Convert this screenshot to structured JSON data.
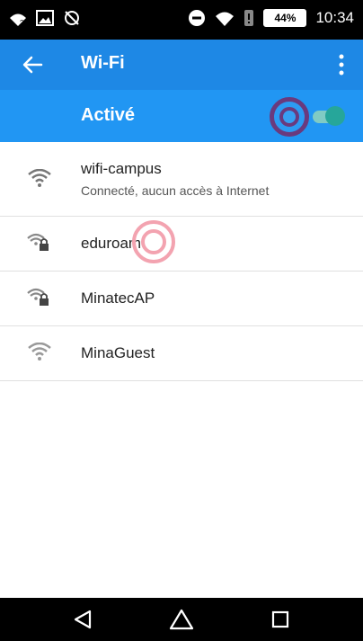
{
  "status_bar": {
    "battery_percent": "44%",
    "time": "10:34"
  },
  "app_bar": {
    "title": "Wi-Fi"
  },
  "wifi_switch": {
    "label": "Activé",
    "state": true
  },
  "networks": [
    {
      "name": "wifi-campus",
      "status": "Connecté, aucun accès à Internet",
      "secured": false
    },
    {
      "name": "eduroam",
      "status": "",
      "secured": true
    },
    {
      "name": "MinatecAP",
      "status": "",
      "secured": true
    },
    {
      "name": "MinaGuest",
      "status": "",
      "secured": false
    }
  ],
  "colors": {
    "app_bar": "#1e88e5",
    "switch_bar": "#2196f3",
    "toggle_thumb": "#26a69a",
    "toggle_track": "#80cbc4"
  },
  "icons": {
    "status": [
      "wifi-question-icon",
      "image-icon",
      "sync-off-icon",
      "do-not-disturb-icon",
      "wifi-signal-icon",
      "notification-icon",
      "battery-icon"
    ],
    "nav": [
      "back-icon",
      "home-icon",
      "recents-icon"
    ]
  }
}
